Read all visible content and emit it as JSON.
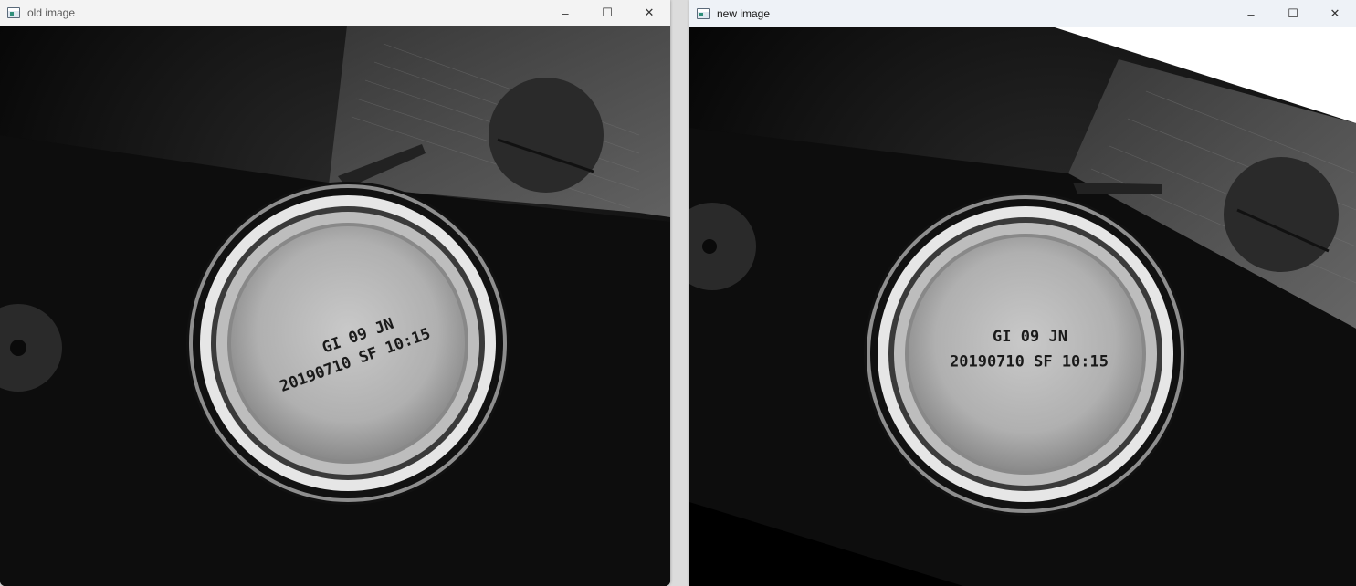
{
  "windows": {
    "old": {
      "title": "old image",
      "icon": "opencv-window-icon",
      "code_line1": "GI 09  JN",
      "code_line2": "20190710 SF 10:15"
    },
    "new": {
      "title": "new image",
      "icon": "opencv-window-icon",
      "code_line1": "GI 09  JN",
      "code_line2": "20190710 SF 10:15"
    }
  },
  "caption_buttons": {
    "minimize": "–",
    "maximize": "☐",
    "close": "✕"
  }
}
